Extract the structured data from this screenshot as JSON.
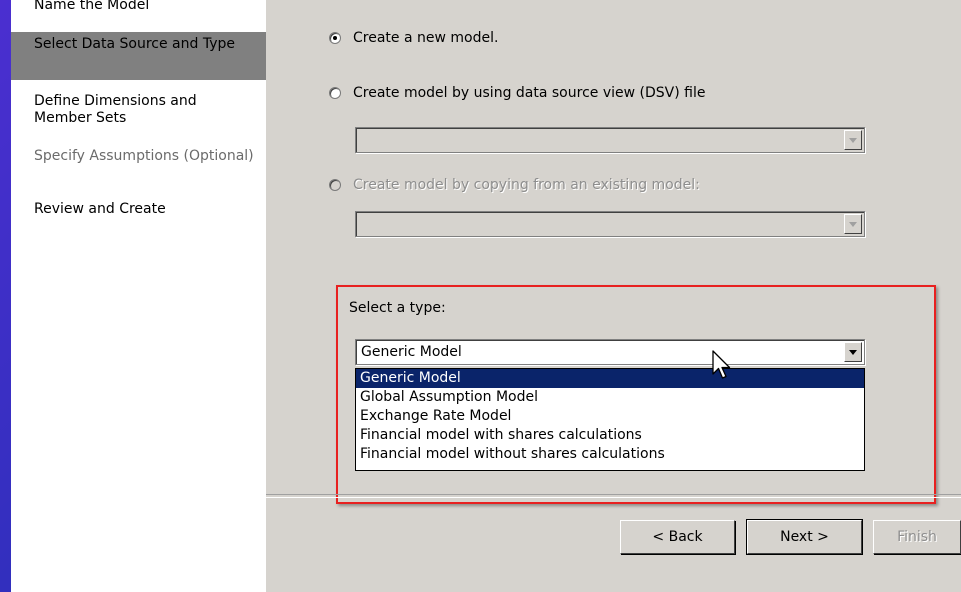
{
  "nav": {
    "items": [
      {
        "label": "Name the Model",
        "state": "normal"
      },
      {
        "label": "Select Data Source and Type",
        "state": "selected"
      },
      {
        "label": "Define Dimensions and Member Sets",
        "state": "normal"
      },
      {
        "label": "Specify Assumptions (Optional)",
        "state": "disabled"
      },
      {
        "label": "Review and Create",
        "state": "normal"
      }
    ]
  },
  "options": {
    "new_model": {
      "label": "Create a new model.",
      "checked": true
    },
    "from_dsv": {
      "label": "Create model by using data source view (DSV) file",
      "checked": false
    },
    "copy_existing": {
      "label": "Create model by copying from an existing model:",
      "checked": false,
      "disabled": true
    }
  },
  "type_select": {
    "label": "Select a type:",
    "selected": "Generic Model",
    "options": [
      "Generic Model",
      "Global Assumption Model",
      "Exchange Rate Model",
      "Financial model with shares calculations",
      "Financial model without shares calculations"
    ]
  },
  "buttons": {
    "back": "< Back",
    "next": "Next >",
    "finish": "Finish"
  },
  "icons": {
    "cursor": "arrow-pointer-icon",
    "dropdown": "chevron-down-icon"
  },
  "colors": {
    "highlight": "#0a246a",
    "annotation": "#e82020",
    "dialog_bg": "#d6d3ce"
  }
}
